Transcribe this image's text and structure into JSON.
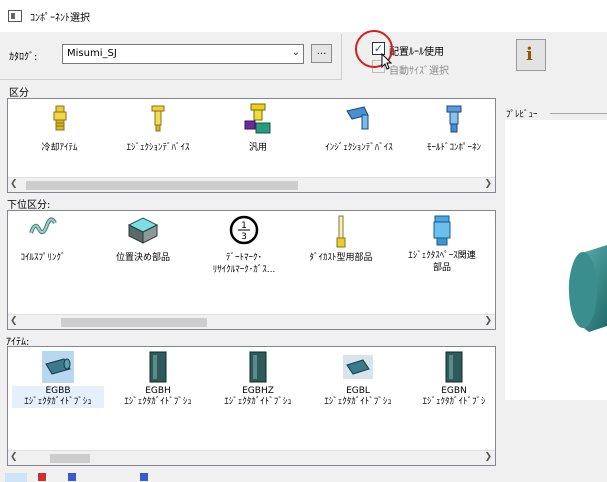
{
  "window": {
    "title": "ｺﾝﾎﾟｰﾈﾝﾄ選択"
  },
  "catalog": {
    "label": "ｶﾀﾛｸﾞ:",
    "value": "Misumi_SJ",
    "browse_label": "..."
  },
  "options": {
    "placement_rule": {
      "label": "配置ﾙｰﾙ使用",
      "checked": true
    },
    "auto_size": {
      "label": "自動ｻｲｽﾞ選択",
      "enabled": false
    }
  },
  "info_button": {
    "glyph": "i",
    "icon": "info-icon"
  },
  "categories": {
    "label": "区分",
    "items": [
      {
        "label": "冷却ｱｲﾃﾑ",
        "icon": "cooling-fitting-icon"
      },
      {
        "label": "ｴｼﾞｪｸｼｮﾝﾃﾞﾊﾞｲｽ",
        "icon": "ejector-pin-icon"
      },
      {
        "label": "汎用",
        "icon": "general-parts-icon"
      },
      {
        "label": "ｲﾝｼﾞｪｸｼｮﾝﾃﾞﾊﾞｲｽ",
        "icon": "injection-device-icon"
      },
      {
        "label": "ﾓｰﾙﾄﾞｺﾝﾎﾟｰﾈﾝ",
        "icon": "mold-component-icon"
      }
    ]
  },
  "subcategories": {
    "label": "下位区分:",
    "items": [
      {
        "label": "ｺｲﾙｽﾌﾟﾘﾝｸﾞ",
        "icon": "coil-spring-icon"
      },
      {
        "label": "位置決め部品",
        "icon": "locating-block-icon"
      },
      {
        "label": "ﾃﾞｰﾄﾏｰｸ･",
        "label2": "ﾘｻｲｸﾙﾏｰｸ･ｶﾞｽ...",
        "icon": "date-mark-icon"
      },
      {
        "label": "ﾀﾞｲｶｽﾄ型用部品",
        "icon": "die-cast-pin-icon"
      },
      {
        "label": "ｴｼﾞｪｸﾀｽﾍﾟｰｽ関連",
        "label2": "部品",
        "icon": "ejector-space-part-icon"
      }
    ]
  },
  "items": {
    "label": "ｱｲﾃﾑ:",
    "entries": [
      {
        "name": "EGBB",
        "desc": "ｴｼﾞｪｸﾀｶﾞｲﾄﾞﾌﾞｼｭ",
        "icon": "guide-bush-icon",
        "selected": true
      },
      {
        "name": "EGBH",
        "desc": "ｴｼﾞｪｸﾀｶﾞｲﾄﾞﾌﾞｼｭ",
        "icon": "guide-bush-icon"
      },
      {
        "name": "EGBHZ",
        "desc": "ｴｼﾞｪｸﾀｶﾞｲﾄﾞﾌﾞｼｭ",
        "icon": "guide-bush-icon"
      },
      {
        "name": "EGBL",
        "desc": "ｴｼﾞｪｸﾀｶﾞｲﾄﾞﾌﾞｼｭ",
        "icon": "guide-bush-icon"
      },
      {
        "name": "EGBN",
        "desc": "ｴｼﾞｪｸﾀｶﾞｲﾄﾞﾌﾞｼ",
        "icon": "guide-bush-icon"
      }
    ]
  },
  "preview": {
    "label": "ﾌﾟﾚﾋﾞｭｰ"
  },
  "colors": {
    "accent": "#2a8a8a",
    "selection": "#e5f0fb",
    "highlight_circle": "#d61f1f"
  }
}
